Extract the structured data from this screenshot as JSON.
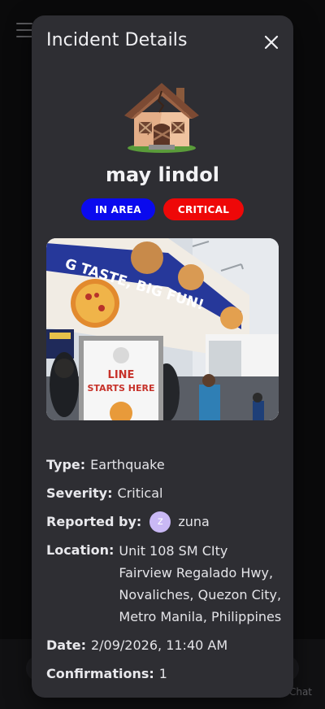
{
  "modal": {
    "title": "Incident Details",
    "name": "may lindol",
    "badges": {
      "area": "IN AREA",
      "severity": "CRITICAL"
    },
    "fields": {
      "type_label": "Type:",
      "type_value": "Earthquake",
      "severity_label": "Severity:",
      "severity_value": "Critical",
      "reporter_label": "Reported by:",
      "reporter_initial": "z",
      "reporter_name": "zuna",
      "location_label": "Location:",
      "location_value": "Unit 108 SM CIty Fairview Regalado Hwy, Novaliches, Quezon City, Metro Manila, Philippines",
      "date_label": "Date:",
      "date_value": "2/09/2026, 11:40 AM",
      "confirmations_label": "Confirmations:",
      "confirmations_value": "1"
    },
    "photo": {
      "banner_text": "G TASTE, BIG FUN!",
      "sign_line1": "LINE",
      "sign_line2": "STARTS HERE"
    }
  },
  "background": {
    "chat_label": "Chat"
  },
  "colors": {
    "modal_bg": "#2e2e33",
    "badge_area": "#0a0aee",
    "badge_critical": "#ee0808",
    "avatar": "#c9b8f5"
  },
  "icons": {
    "menu": "menu-icon",
    "close": "close-icon",
    "incident": "damaged-house-icon"
  }
}
